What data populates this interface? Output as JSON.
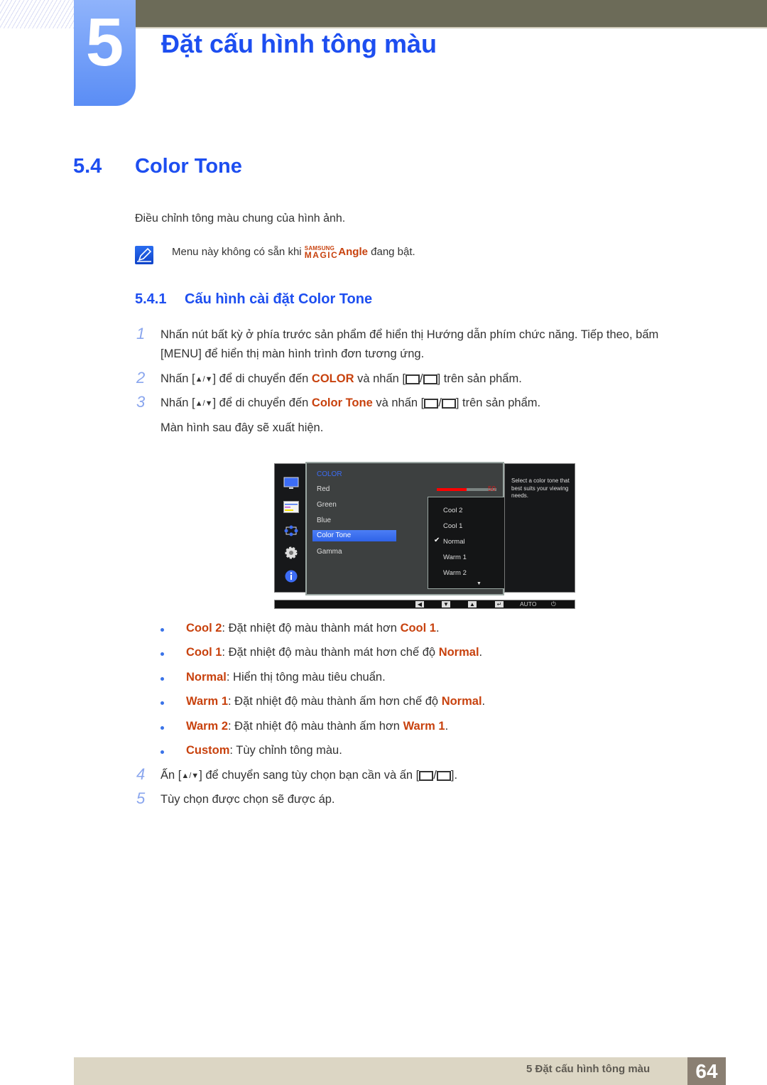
{
  "chapter": {
    "number": "5",
    "title": "Đặt cấu hình tông màu"
  },
  "section": {
    "number": "5.4",
    "title": "Color Tone",
    "intro": "Điều chỉnh tông màu chung của hình ảnh.",
    "note": {
      "before": "Menu này không có sẵn khi ",
      "brand_top": "SAMSUNG",
      "brand_bottom": "MAGIC",
      "brand_feature": "Angle",
      "after": " đang bật."
    }
  },
  "subsection": {
    "number": "5.4.1",
    "title": "Cấu hình cài đặt Color Tone"
  },
  "steps": [
    {
      "num": "1",
      "line1": "Nhấn nút bất kỳ ở phía trước sản phẩm để hiển thị Hướng dẫn phím chức năng. Tiếp theo, bấm",
      "line2_pre": "[",
      "line2_key": "MENU",
      "line2_post": "] để hiển thị màn hình trình đơn tương ứng."
    },
    {
      "num": "2",
      "pre": "Nhấn [",
      "updown": "▲/▼",
      "mid": "] để di chuyển đến ",
      "target": "COLOR",
      "post": " và nhấn [",
      "post2": "] trên sản phẩm."
    },
    {
      "num": "3",
      "pre": "Nhấn [",
      "updown": "▲/▼",
      "mid": "] để di chuyển đến ",
      "target": "Color Tone",
      "post": " và nhấn [",
      "post2": "] trên sản phẩm.",
      "follow": "Màn hình sau đây sẽ xuất hiện."
    },
    {
      "num": "4",
      "pre": "Ấn [",
      "updown": "▲/▼",
      "mid": "] để chuyển sang tùy chọn bạn cần và ấn [",
      "post2": "]."
    },
    {
      "num": "5",
      "text": "Tùy chọn được chọn sẽ được áp."
    }
  ],
  "osd": {
    "menu_title": "COLOR",
    "items": [
      "Red",
      "Green",
      "Blue",
      "Color Tone",
      "Gamma"
    ],
    "selected_item": "Color Tone",
    "red_value": "50",
    "red_fraction": 0.5,
    "options": [
      "Cool 2",
      "Cool 1",
      "Normal",
      "Warm 1",
      "Warm 2"
    ],
    "checked_option": "Normal",
    "check_glyph": "✔",
    "more_glyph": "▼",
    "help": "Select a color tone that best suits your viewing needs.",
    "side_icons": [
      "monitor-icon",
      "color-bars-icon",
      "size-position-icon",
      "gear-icon",
      "info-icon"
    ],
    "bottom_buttons": [
      "◀",
      "▼",
      "▲",
      "↵",
      "AUTO",
      "⏻"
    ]
  },
  "bullets": [
    {
      "term": "Cool 2",
      "text": ": Đặt nhiệt độ màu thành mát hơn ",
      "ref": "Cool 1",
      "end": "."
    },
    {
      "term": "Cool 1",
      "text": ": Đặt nhiệt độ màu thành mát hơn chế độ ",
      "ref": "Normal",
      "end": "."
    },
    {
      "term": "Normal",
      "text": ": Hiển thị tông màu tiêu chuẩn.",
      "ref": "",
      "end": ""
    },
    {
      "term": "Warm 1",
      "text": ": Đặt nhiệt độ màu thành ấm hơn chế độ ",
      "ref": "Normal",
      "end": "."
    },
    {
      "term": "Warm 2",
      "text": ": Đặt nhiệt độ màu thành ấm hơn ",
      "ref": "Warm 1",
      "end": "."
    },
    {
      "term": "Custom",
      "text": ": Tùy chỉnh tông màu.",
      "ref": "",
      "end": ""
    }
  ],
  "footer": {
    "chapter_label": "5 Đặt cấu hình tông màu",
    "page": "64"
  },
  "colors": {
    "heading_blue": "#1d4ef0",
    "highlight_orange": "#c8420e",
    "topbar": "#6c6b58",
    "footer_bg": "#dcd6c4",
    "page_box": "#8a7f72"
  }
}
